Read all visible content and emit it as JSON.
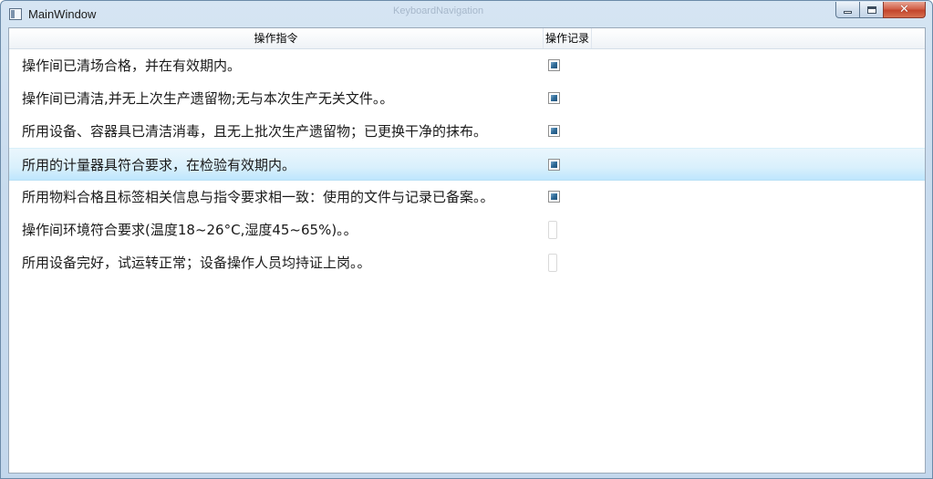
{
  "window": {
    "title": "MainWindow",
    "ghost_title": "KeyboardNavigation"
  },
  "controls": {
    "minimize": "minimize",
    "maximize": "maximize",
    "close": "✕"
  },
  "table": {
    "columns": [
      "操作指令",
      "操作记录"
    ],
    "rows": [
      {
        "instruction": "操作间已清场合格，并在有效期内。",
        "checked": true
      },
      {
        "instruction": "操作间已清洁,并无上次生产遗留物;无与本次生产无关文件。。",
        "checked": true
      },
      {
        "instruction": "所用设备、容器具已清洁消毒，且无上批次生产遗留物；已更换干净的抹布。",
        "checked": true
      },
      {
        "instruction": "所用的计量器具符合要求，在检验有效期内。",
        "checked": true,
        "selected": true
      },
      {
        "instruction": "所用物料合格且标签相关信息与指令要求相一致：使用的文件与记录已备案。。",
        "checked": true
      },
      {
        "instruction": "操作间环境符合要求(温度18~26°C,湿度45~65%)。。",
        "checked": false
      },
      {
        "instruction": "所用设备完好，试运转正常；设备操作人员均持证上岗。。",
        "checked": false
      }
    ]
  }
}
